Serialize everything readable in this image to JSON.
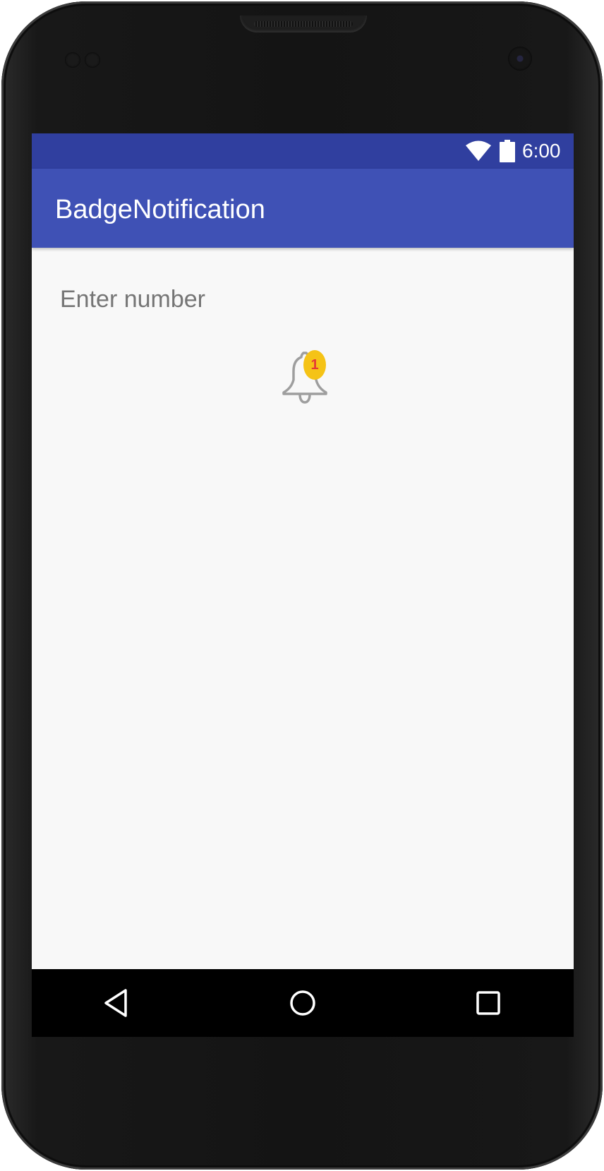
{
  "status_bar": {
    "time": "6:00",
    "wifi_icon": "wifi-icon",
    "battery_icon": "battery-icon"
  },
  "app_bar": {
    "title": "BadgeNotification"
  },
  "main": {
    "number_input": {
      "value": "",
      "placeholder": "Enter number"
    },
    "notification": {
      "icon": "bell-icon",
      "badge_count": "1",
      "badge_color": "#f5c316",
      "badge_text_color": "#e53935"
    }
  },
  "nav_bar": {
    "back_icon": "back-triangle-icon",
    "home_icon": "home-circle-icon",
    "recents_icon": "recents-square-icon"
  },
  "colors": {
    "status_bar": "#303f9f",
    "app_bar": "#3f51b5",
    "background": "#f8f8f8",
    "nav_bar": "#000000"
  }
}
